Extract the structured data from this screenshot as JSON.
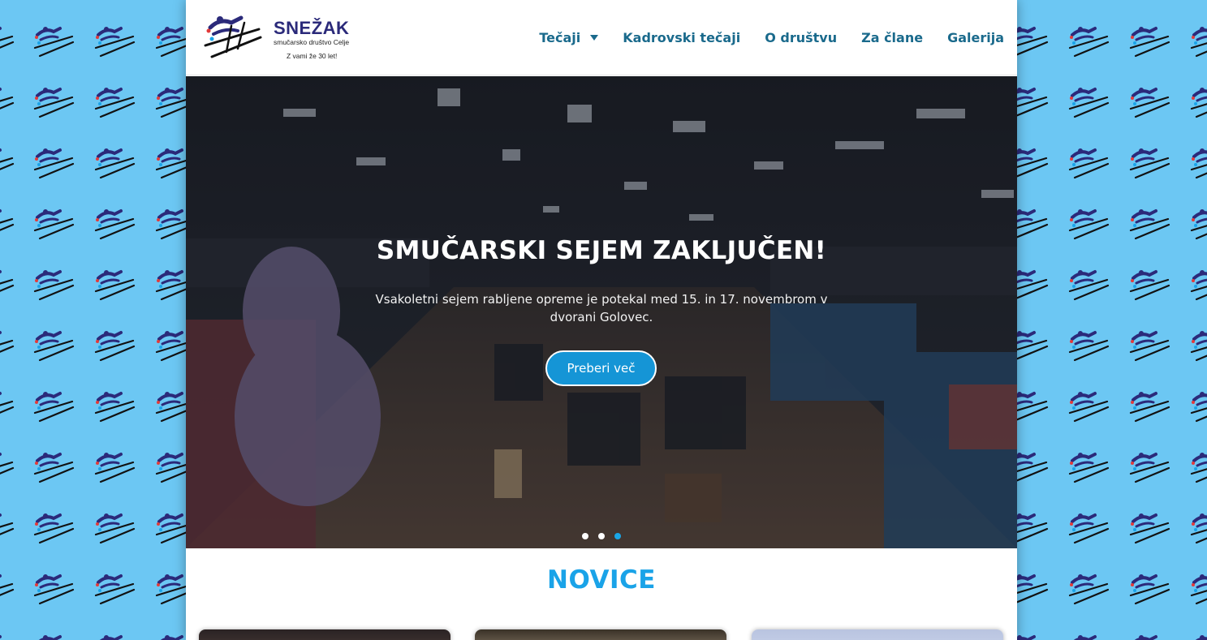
{
  "brand": {
    "name": "SNEŽAK",
    "subtitle": "smučarsko društvo Celje",
    "tagline": "Z vami že 30 let!"
  },
  "nav": {
    "items": [
      {
        "label": "Tečaji",
        "has_dropdown": true
      },
      {
        "label": "Kadrovski tečaji"
      },
      {
        "label": "O društvu"
      },
      {
        "label": "Za člane"
      },
      {
        "label": "Galerija"
      }
    ]
  },
  "hero": {
    "title": "SMUČARSKI SEJEM ZAKLJUČEN!",
    "text": "Vsakoletni sejem rabljene opreme je potekal med 15. in 17. novembrom v dvorani Golovec.",
    "button_label": "Preberi več",
    "slides_total": 3,
    "active_slide": 3
  },
  "news": {
    "title": "NOVICE"
  },
  "colors": {
    "background": "#6cc7f3",
    "accent": "#1aa3e8",
    "nav_text": "#1a6a8c",
    "brand_navy": "#2b2a7a"
  },
  "icons": {
    "caret": "caret-down-icon",
    "logo": "skier-logo-icon"
  }
}
